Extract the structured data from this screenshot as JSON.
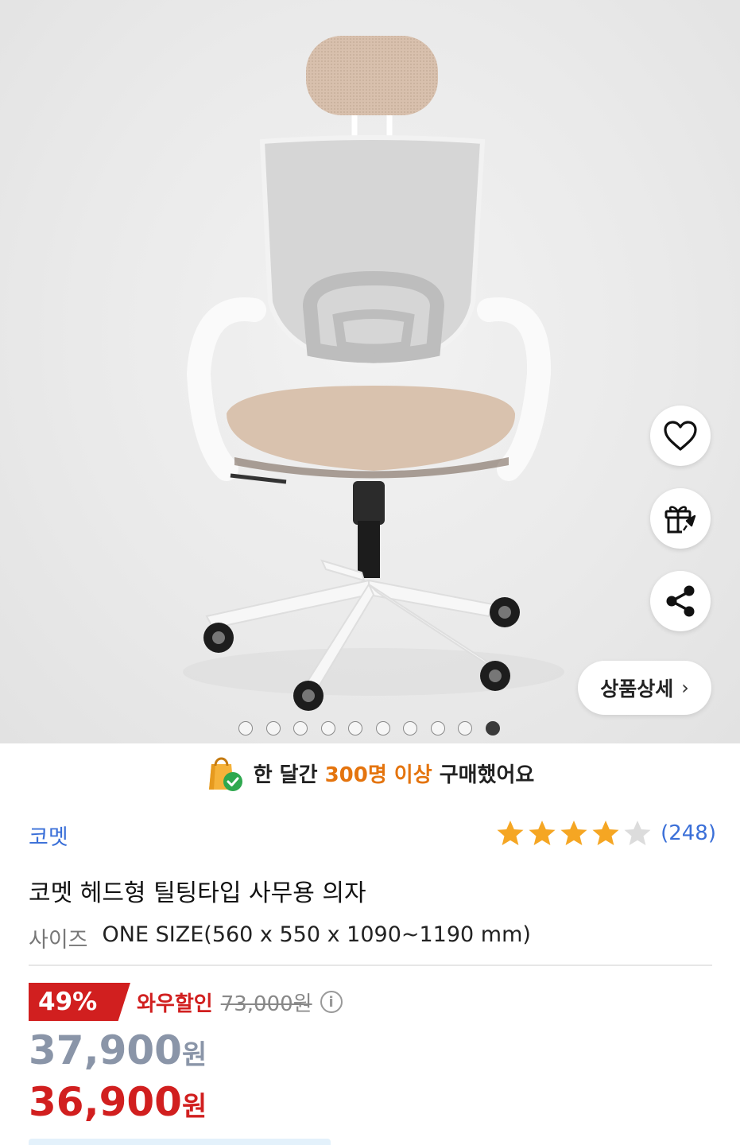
{
  "hero": {
    "dots_total": 10,
    "active_dot_index": 9,
    "detail_button_label": "상품상세",
    "detail_chevron": "›",
    "icons": [
      "heart-icon",
      "gift-rocket-icon",
      "share-icon"
    ]
  },
  "banner": {
    "prefix": "한 달간 ",
    "highlight": "300명 이상",
    "suffix": " 구매했어요",
    "icon": "shopping-bag-check-icon"
  },
  "product": {
    "brand": "코멧",
    "rating_stars": 4,
    "rating_max": 5,
    "review_count": "(248)",
    "title": "코멧 헤드형 틸팅타입 사무용 의자",
    "size_label": "사이즈",
    "size_value": "ONE SIZE(560 x 550 x 1090~1190 mm)"
  },
  "price": {
    "discount_pct": "49%",
    "wow_label": "와우할인",
    "original": "73,000원",
    "sale_amount": "37,900",
    "wow_amount": "36,900",
    "currency": "원"
  },
  "colors": {
    "accent_blue": "#3a6fd8",
    "sale_red": "#d11f1f",
    "highlight_orange": "#e4740e",
    "star_gold": "#f5a623"
  }
}
